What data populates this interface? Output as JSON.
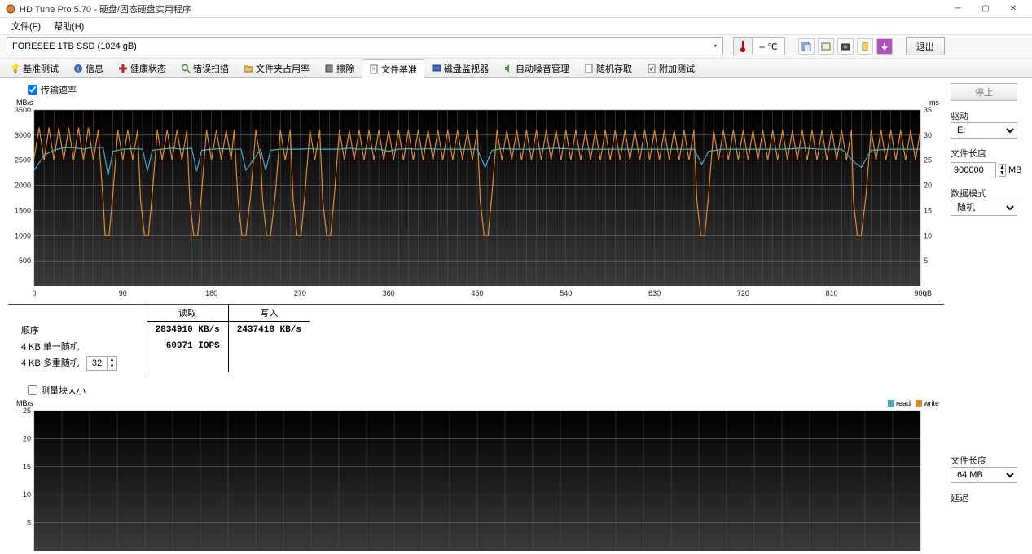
{
  "window": {
    "title": "HD Tune Pro 5.70 - 硬盘/固态硬盘实用程序"
  },
  "menu": {
    "file": "文件(F)",
    "help": "帮助(H)"
  },
  "drive": {
    "selected": "FORESEE 1TB SSD (1024 gB)"
  },
  "temp": {
    "display": "-- ℃"
  },
  "exit_label": "退出",
  "tabs": {
    "benchmark": "基准测试",
    "info": "信息",
    "health": "健康状态",
    "errorscan": "错误扫描",
    "folderusage": "文件夹占用率",
    "erase": "擦除",
    "filebench": "文件基准",
    "diskmon": "磁盘监视器",
    "aam": "自动噪音管理",
    "randomaccess": "随机存取",
    "extra": "附加测试"
  },
  "upper": {
    "checkbox_label": "传输速率",
    "y_unit": "MB/s",
    "y2_unit": "ms",
    "x_unit": "gB",
    "y_ticks": [
      "500",
      "1000",
      "1500",
      "2000",
      "2500",
      "3000",
      "3500"
    ],
    "y2_ticks": [
      "5",
      "10",
      "15",
      "20",
      "25",
      "30",
      "35"
    ],
    "x_ticks": [
      "0",
      "90",
      "180",
      "270",
      "360",
      "450",
      "540",
      "630",
      "720",
      "810",
      "900"
    ]
  },
  "results": {
    "hdr_read": "读取",
    "hdr_write": "写入",
    "row_seq": "顺序",
    "row_4k_single": "4 KB 单一随机",
    "row_4k_multi": "4 KB 多重随机",
    "seq_read": "2834910 KB/s",
    "seq_write": "2437418 KB/s",
    "iops_4k": "60971 IOPS",
    "multi_queue": "32"
  },
  "lower": {
    "checkbox_label": "测量块大小",
    "y_unit": "MB/s",
    "y_ticks": [
      "5",
      "10",
      "15",
      "20",
      "25"
    ],
    "legend_read": "read",
    "legend_write": "write"
  },
  "side": {
    "stop": "停止",
    "drive_label": "驱动",
    "drive_value": "E:",
    "filelen_label": "文件长度",
    "filelen_value": "900000",
    "filelen_unit": "MB",
    "datamode_label": "数据模式",
    "datamode_value": "随机",
    "filelen2_label": "文件长度",
    "filelen2_value": "64 MB",
    "delay_label": "延迟"
  },
  "chart_data": [
    {
      "type": "line",
      "title": "传输速率",
      "xlabel": "gB",
      "ylabel": "MB/s",
      "y2label": "ms",
      "xlim": [
        0,
        900
      ],
      "ylim": [
        0,
        3500
      ],
      "y2lim": [
        0,
        35
      ],
      "series": [
        {
          "name": "write (MB/s)",
          "color": "#e08a2a",
          "x": [
            0,
            5,
            10,
            15,
            20,
            25,
            30,
            35,
            40,
            45,
            50,
            55,
            60,
            65,
            70,
            72,
            76,
            80,
            85,
            90,
            95,
            100,
            105,
            108,
            112,
            116,
            120,
            125,
            130,
            135,
            140,
            145,
            150,
            155,
            158,
            162,
            166,
            170,
            175,
            180,
            185,
            190,
            195,
            200,
            203,
            207,
            211,
            215,
            220,
            225,
            230,
            232,
            236,
            240,
            245,
            250,
            255,
            260,
            263,
            267,
            271,
            275,
            280,
            285,
            290,
            293,
            297,
            301,
            305,
            310,
            315,
            320,
            325,
            330,
            335,
            340,
            345,
            350,
            355,
            360,
            365,
            370,
            375,
            380,
            385,
            390,
            395,
            400,
            405,
            410,
            415,
            420,
            425,
            430,
            435,
            440,
            445,
            450,
            453,
            457,
            461,
            465,
            470,
            475,
            480,
            485,
            490,
            495,
            500,
            505,
            510,
            515,
            520,
            525,
            530,
            535,
            540,
            545,
            550,
            555,
            560,
            565,
            570,
            575,
            580,
            585,
            590,
            595,
            600,
            605,
            610,
            615,
            620,
            625,
            630,
            635,
            640,
            645,
            650,
            655,
            660,
            665,
            670,
            673,
            677,
            681,
            685,
            690,
            695,
            700,
            705,
            710,
            715,
            720,
            725,
            730,
            735,
            740,
            745,
            750,
            755,
            760,
            765,
            770,
            775,
            780,
            785,
            790,
            795,
            800,
            805,
            810,
            815,
            820,
            825,
            830,
            832,
            836,
            840,
            845,
            850,
            855,
            860,
            865,
            870,
            875,
            880,
            885,
            890,
            895,
            900
          ],
          "values": [
            2550,
            3150,
            2500,
            3150,
            2500,
            3150,
            2500,
            3150,
            2500,
            3150,
            2500,
            3150,
            2500,
            3100,
            1700,
            1000,
            1000,
            1850,
            3100,
            2500,
            3100,
            2500,
            3100,
            1700,
            1000,
            1000,
            1850,
            3100,
            2500,
            3100,
            2500,
            3100,
            2500,
            3100,
            1700,
            1000,
            1000,
            1850,
            3100,
            2500,
            3100,
            2500,
            3100,
            2500,
            3100,
            1700,
            1000,
            1000,
            1850,
            3100,
            2500,
            1700,
            1000,
            1000,
            1850,
            3100,
            2500,
            3100,
            1700,
            1000,
            1000,
            1850,
            3100,
            2500,
            3100,
            1700,
            1000,
            1000,
            1850,
            3100,
            2500,
            3100,
            2500,
            3100,
            2500,
            3100,
            2500,
            3100,
            2500,
            3100,
            2500,
            3100,
            2500,
            3100,
            2500,
            3100,
            2500,
            3100,
            2500,
            3100,
            2500,
            3100,
            2500,
            3100,
            2500,
            3100,
            2500,
            3100,
            1700,
            1000,
            1000,
            1850,
            3100,
            2500,
            3100,
            2500,
            3100,
            2500,
            3100,
            2500,
            3100,
            2500,
            3100,
            2500,
            3100,
            2500,
            3100,
            2500,
            3100,
            2500,
            3100,
            2500,
            3100,
            2500,
            3100,
            2500,
            3100,
            2500,
            3100,
            2500,
            3100,
            2500,
            3100,
            2500,
            3100,
            2500,
            3100,
            2500,
            3100,
            2500,
            3100,
            2500,
            3100,
            1700,
            1000,
            1000,
            1850,
            3100,
            2500,
            3100,
            2500,
            3100,
            2500,
            3100,
            2500,
            3100,
            2500,
            3100,
            2500,
            3100,
            2500,
            3100,
            2500,
            3100,
            2500,
            3100,
            2500,
            3100,
            2500,
            3100,
            2500,
            3100,
            2500,
            3100,
            2500,
            3100,
            1700,
            1000,
            1000,
            1850,
            3100,
            2500,
            3100,
            2500,
            3100,
            2500,
            3100,
            2500,
            3100,
            2500,
            3100
          ]
        },
        {
          "name": "read (MB/s)",
          "color": "#4aa8c8",
          "x": [
            0,
            10,
            20,
            30,
            40,
            50,
            60,
            70,
            75,
            80,
            90,
            100,
            110,
            115,
            120,
            130,
            140,
            150,
            160,
            165,
            170,
            180,
            190,
            200,
            210,
            215,
            230,
            235,
            240,
            250,
            260,
            270,
            280,
            290,
            300,
            310,
            320,
            330,
            340,
            350,
            360,
            370,
            380,
            390,
            400,
            410,
            420,
            430,
            440,
            450,
            458,
            465,
            475,
            490,
            510,
            530,
            550,
            570,
            590,
            610,
            630,
            650,
            670,
            678,
            685,
            700,
            720,
            740,
            760,
            780,
            800,
            820,
            833,
            840,
            850,
            870,
            900
          ],
          "values": [
            2300,
            2600,
            2700,
            2750,
            2750,
            2720,
            2760,
            2750,
            2200,
            2680,
            2720,
            2730,
            2720,
            2280,
            2700,
            2720,
            2740,
            2720,
            2740,
            2280,
            2700,
            2720,
            2730,
            2720,
            2720,
            2300,
            2720,
            2300,
            2700,
            2720,
            2720,
            2720,
            2730,
            2720,
            2720,
            2720,
            2740,
            2720,
            2730,
            2720,
            2680,
            2720,
            2730,
            2720,
            2730,
            2720,
            2720,
            2720,
            2720,
            2720,
            2360,
            2700,
            2730,
            2720,
            2720,
            2740,
            2720,
            2720,
            2720,
            2720,
            2720,
            2720,
            2720,
            2420,
            2680,
            2720,
            2720,
            2720,
            2720,
            2740,
            2720,
            2720,
            2460,
            2360,
            2700,
            2720,
            2720
          ]
        }
      ]
    },
    {
      "type": "line",
      "title": "测量块大小",
      "xlabel": "",
      "ylabel": "MB/s",
      "ylim": [
        0,
        25
      ],
      "series": []
    }
  ]
}
